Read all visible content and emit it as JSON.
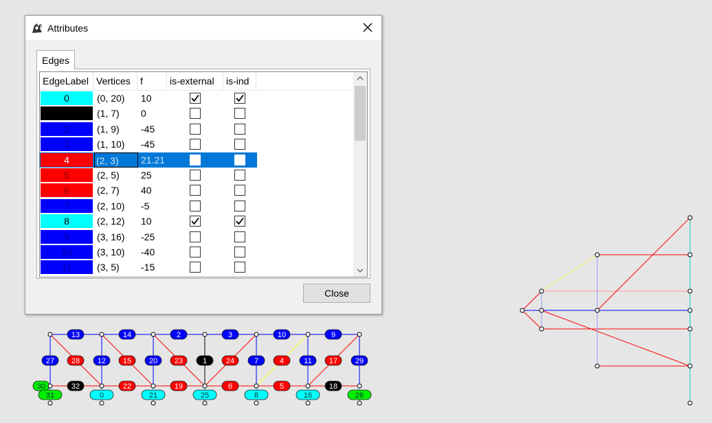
{
  "window": {
    "title": "Attributes",
    "app_icon": "rhino-app-icon",
    "close_icon": "close-x-icon"
  },
  "tabs": [
    {
      "label": "Edges"
    }
  ],
  "table": {
    "columns": [
      "EdgeLabel",
      "Vertices",
      "f",
      "is-external",
      "is-ind"
    ],
    "rows": [
      {
        "label": "0",
        "color": "#00ffff",
        "vertices": "(0, 20)",
        "f": "10",
        "is_external": true,
        "is_ind": true
      },
      {
        "label": "1",
        "color": "#000000",
        "vertices": "(1, 7)",
        "f": "0",
        "is_external": false,
        "is_ind": false
      },
      {
        "label": "2",
        "color": "#0000ff",
        "vertices": "(1, 9)",
        "f": "-45",
        "is_external": false,
        "is_ind": false
      },
      {
        "label": "3",
        "color": "#0000ff",
        "vertices": "(1, 10)",
        "f": "-45",
        "is_external": false,
        "is_ind": false
      },
      {
        "label": "4",
        "color": "#ff0000",
        "vertices": "(2, 3)",
        "f": "21.21",
        "is_external": false,
        "is_ind": false,
        "selected": true
      },
      {
        "label": "5",
        "color": "#ff0000",
        "vertices": "(2, 5)",
        "f": "25",
        "is_external": false,
        "is_ind": false
      },
      {
        "label": "6",
        "color": "#ff0000",
        "vertices": "(2, 7)",
        "f": "40",
        "is_external": false,
        "is_ind": false
      },
      {
        "label": "7",
        "color": "#0000ff",
        "vertices": "(2, 10)",
        "f": "-5",
        "is_external": false,
        "is_ind": false
      },
      {
        "label": "8",
        "color": "#00ffff",
        "vertices": "(2, 12)",
        "f": "10",
        "is_external": true,
        "is_ind": true
      },
      {
        "label": "9",
        "color": "#0000ff",
        "vertices": "(3, 16)",
        "f": "-25",
        "is_external": false,
        "is_ind": false
      },
      {
        "label": "10",
        "color": "#0000ff",
        "vertices": "(3, 10)",
        "f": "-40",
        "is_external": false,
        "is_ind": false
      },
      {
        "label": "11",
        "color": "#0000ff",
        "vertices": "(3, 5)",
        "f": "-15",
        "is_external": false,
        "is_ind": false
      }
    ]
  },
  "buttons": {
    "close_label": "Close"
  },
  "graph_bottom": {
    "top_labels": [
      {
        "t": "13",
        "c": "#0000ff"
      },
      {
        "t": "14",
        "c": "#0000ff"
      },
      {
        "t": "2",
        "c": "#0000ff"
      },
      {
        "t": "3",
        "c": "#0000ff"
      },
      {
        "t": "10",
        "c": "#0000ff"
      },
      {
        "t": "9",
        "c": "#0000ff"
      }
    ],
    "mid_labels": [
      {
        "t": "27",
        "c": "#0000ff"
      },
      {
        "t": "28",
        "c": "#ff0000"
      },
      {
        "t": "12",
        "c": "#0000ff"
      },
      {
        "t": "15",
        "c": "#ff0000"
      },
      {
        "t": "20",
        "c": "#0000ff"
      },
      {
        "t": "23",
        "c": "#ff0000"
      },
      {
        "t": "1",
        "c": "#000000"
      },
      {
        "t": "24",
        "c": "#ff0000"
      },
      {
        "t": "7",
        "c": "#0000ff"
      },
      {
        "t": "4",
        "c": "#ff0000"
      },
      {
        "t": "11",
        "c": "#0000ff"
      },
      {
        "t": "17",
        "c": "#ff0000"
      },
      {
        "t": "29",
        "c": "#0000ff"
      }
    ],
    "bottom_labels": [
      {
        "t": "30",
        "c": "#00ee00"
      },
      {
        "t": "32",
        "c": "#000000"
      },
      {
        "t": "22",
        "c": "#ff0000"
      },
      {
        "t": "19",
        "c": "#ff0000"
      },
      {
        "t": "6",
        "c": "#ff0000"
      },
      {
        "t": "5",
        "c": "#ff0000"
      },
      {
        "t": "18",
        "c": "#000000"
      }
    ],
    "reaction_labels": [
      {
        "t": "31",
        "c": "#00ee00"
      },
      {
        "t": "0",
        "c": "#00ffff"
      },
      {
        "t": "21",
        "c": "#00ffff"
      },
      {
        "t": "25",
        "c": "#00ffff"
      },
      {
        "t": "8",
        "c": "#00ffff"
      },
      {
        "t": "16",
        "c": "#00ffff"
      },
      {
        "t": "26",
        "c": "#00ee00"
      }
    ]
  }
}
